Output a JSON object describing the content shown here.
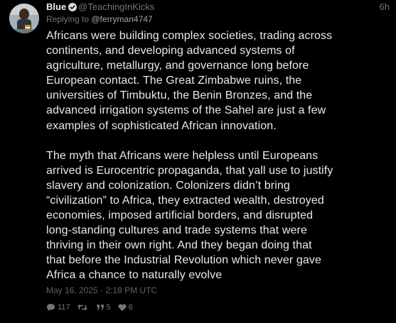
{
  "user": {
    "display_name": "Blue",
    "handle": "@TeachingInKicks",
    "time_ago": "6h"
  },
  "reply": {
    "prefix": "Replying to ",
    "mention": "@ferryman4747"
  },
  "body": {
    "paragraph_1": "Africans were building complex societies, trading across\ncontinents, and developing advanced systems of\nagriculture, metallurgy, and governance long before\nEuropean contact. The Great Zimbabwe ruins, the\nuniversities of Timbuktu, the Benin Bronzes, and the\nadvanced irrigation systems of the Sahel are just a few\nexamples of sophisticated African innovation.",
    "paragraph_2": "The myth that Africans were helpless until Europeans\narrived is Eurocentric propaganda, that yall use to justify\nslavery and colonization. Colonizers didn’t bring\n“civilization” to Africa, they extracted wealth, destroyed\neconomies, imposed artificial borders, and disrupted\nlong-standing cultures and trade systems that were\nthriving in their own right. And they began doing that\nthat before the Industrial Revolution which never gave\nAfrica a chance to naturally evolve"
  },
  "timestamp": "May 16, 2025 · 2:18 PM UTC",
  "actions": {
    "replies": "117",
    "retweets": "",
    "quotes": "5",
    "likes": "6"
  },
  "icons": {
    "verified": "verified-badge-icon",
    "reply": "comment-icon",
    "retweet": "retweet-icon",
    "quote": "quote-icon",
    "like": "heart-icon"
  },
  "colors": {
    "background": "#000000",
    "text": "#e7e9ea",
    "muted": "#71767b",
    "verified": "#1d9bf0"
  }
}
